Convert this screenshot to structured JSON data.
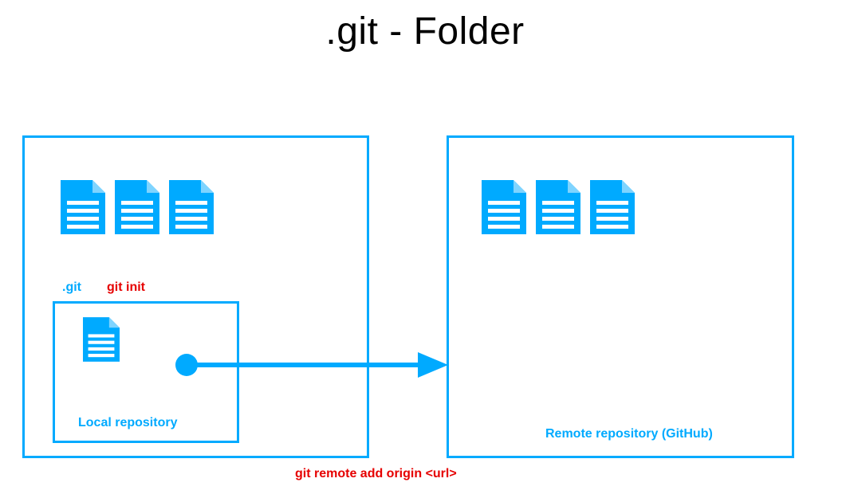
{
  "title": ".git - Folder",
  "local": {
    "dotgit_label": ".git",
    "gitinit_label": "git init",
    "local_repo_label": "Local repository"
  },
  "remote": {
    "remote_repo_label": "Remote repository (GitHub)"
  },
  "command_label": "git remote add origin <url>",
  "colors": {
    "accent": "#00aaff",
    "danger": "#e60000"
  }
}
